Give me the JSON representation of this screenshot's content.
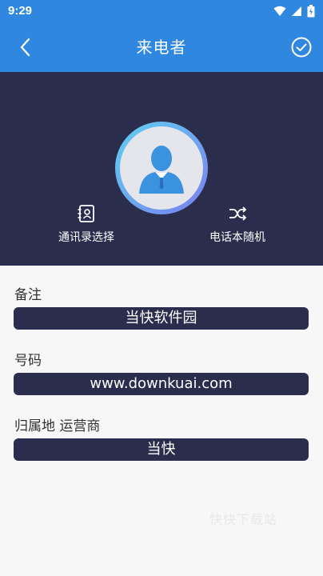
{
  "status_bar": {
    "time": "9:29"
  },
  "app_bar": {
    "title": "来电者"
  },
  "actions": {
    "contacts_label": "通讯录选择",
    "random_label": "电话本随机"
  },
  "form": {
    "note": {
      "label": "备注",
      "value": "当快软件园"
    },
    "number": {
      "label": "号码",
      "value": "www.downkuai.com"
    },
    "location": {
      "label": "归属地 运营商",
      "value": "当快"
    }
  },
  "watermark": "快快下载站",
  "colors": {
    "primary": "#2f87e0",
    "dark": "#2b2d4d",
    "background": "#f7f7f8"
  }
}
